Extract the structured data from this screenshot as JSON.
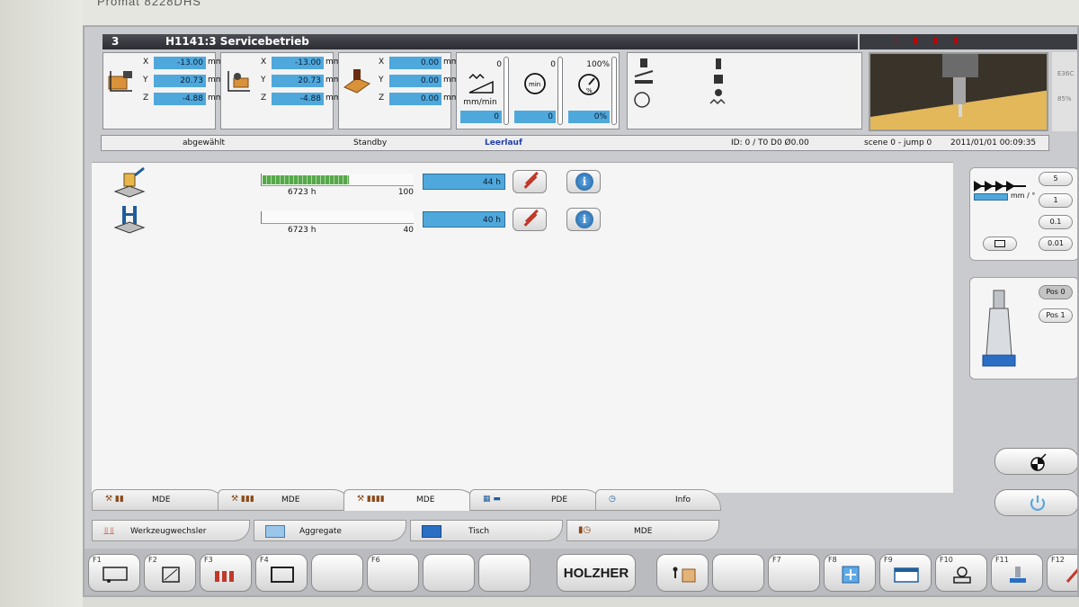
{
  "bezel": {
    "model": "Promat 8228DHS"
  },
  "title": {
    "number": "3",
    "text": "H1141:3 Servicebetrieb"
  },
  "axes": [
    {
      "icon": "tool-1-icon",
      "rows": [
        {
          "axis": "X",
          "value": "-13.00",
          "unit": "mm"
        },
        {
          "axis": "Y",
          "value": "20.73",
          "unit": "mm"
        },
        {
          "axis": "Z",
          "value": "-4.88",
          "unit": "mm"
        }
      ]
    },
    {
      "icon": "tool-2-icon",
      "rows": [
        {
          "axis": "X",
          "value": "-13.00",
          "unit": "mm"
        },
        {
          "axis": "Y",
          "value": "20.73",
          "unit": "mm"
        },
        {
          "axis": "Z",
          "value": "-4.88",
          "unit": "mm"
        }
      ]
    },
    {
      "icon": "tool-3-icon",
      "rows": [
        {
          "axis": "X",
          "value": "0.00",
          "unit": "mm"
        },
        {
          "axis": "Y",
          "value": "0.00",
          "unit": "mm"
        },
        {
          "axis": "Z",
          "value": "0.00",
          "unit": "mm"
        }
      ]
    }
  ],
  "feed": [
    {
      "top": "0",
      "sub": "mm/min",
      "value": "0"
    },
    {
      "top": "0",
      "sub": "",
      "value": "0"
    },
    {
      "top": "100%",
      "sub": "",
      "value": "0%"
    }
  ],
  "edge_labels": {
    "a": "E36C",
    "b": "85%"
  },
  "status": {
    "selection": "abgewählt",
    "mode": "Standby",
    "state": "Leerlauf",
    "tool": "ID: 0 / T0 D0 Ø0.00",
    "scene": "scene 0 - jump 0",
    "datetime": "2011/01/01 00:09:35"
  },
  "counters": [
    {
      "icon": "glue-unit-icon",
      "progress": 0.57,
      "hours": "6723 h",
      "max": "100",
      "count": "44 h"
    },
    {
      "icon": "service-unit-icon",
      "progress": 0.0,
      "hours": "6723 h",
      "max": "40",
      "count": "40 h"
    }
  ],
  "side": {
    "feed_unit": "mm / °",
    "steps": [
      "5",
      "1",
      "0.1",
      "0.01"
    ],
    "positions": [
      "Pos 0",
      "Pos 1"
    ]
  },
  "tabs": [
    {
      "label": "MDE"
    },
    {
      "label": "MDE"
    },
    {
      "label": "MDE"
    },
    {
      "label": "PDE"
    },
    {
      "label": "Info"
    }
  ],
  "subtabs": [
    {
      "label": "Werkzeugwechsler"
    },
    {
      "label": "Aggregate"
    },
    {
      "label": "Tisch"
    },
    {
      "label": "MDE"
    }
  ],
  "fkeys": [
    "F1",
    "F2",
    "F3",
    "F4",
    "",
    "F6",
    "",
    "",
    "F7",
    "F8",
    "F9",
    "F10",
    "F11",
    "F12"
  ],
  "logo": "HOLZHER",
  "colors": {
    "field": "#4fa8dc",
    "title": "#2c2c33",
    "accent_red": "#c0392b"
  }
}
